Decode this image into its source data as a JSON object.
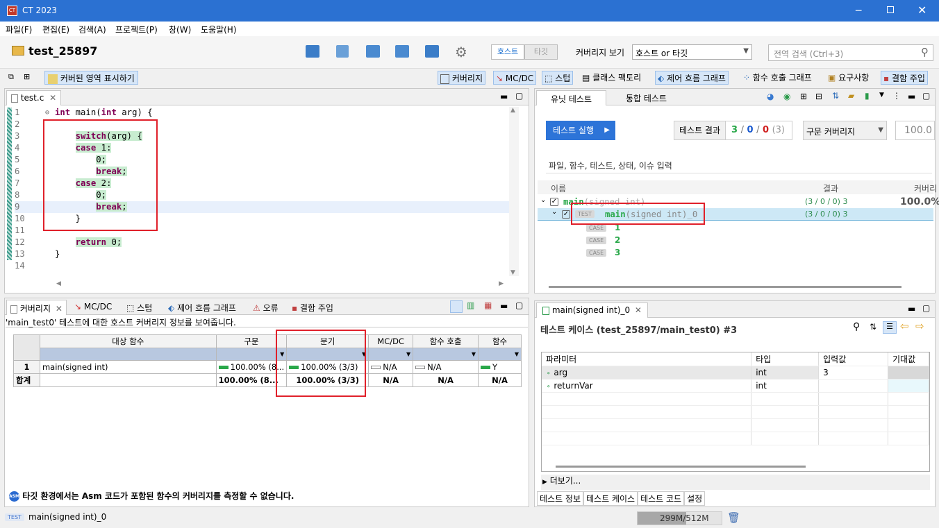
{
  "window": {
    "title": "CT 2023"
  },
  "menu": [
    "파일(F)",
    "편집(E)",
    "검색(A)",
    "프로젝트(P)",
    "창(W)",
    "도움말(H)"
  ],
  "project": {
    "name": "test_25897"
  },
  "toolbar": {
    "host_tab": "호스트",
    "target_tab": "타깃",
    "coverage_view_label": "커버리지 보기",
    "coverage_view_value": "호스트 or 타깃",
    "search_placeholder": "전역 검색 (Ctrl+3)",
    "show_covered": "커버된 영역 표시하기",
    "coverage": "커버리지",
    "mcdc": "MC/DC",
    "stub": "스텁",
    "class_factory": "클래스 팩토리",
    "control_flow": "제어 흐름 그래프",
    "call_graph": "함수 호출 그래프",
    "requirements": "요구사항",
    "fault_injection": "결함 주입"
  },
  "editor": {
    "tab": "test.c",
    "lines": [
      {
        "n": "1",
        "code": "int main(int arg) {"
      },
      {
        "n": "2",
        "code": ""
      },
      {
        "n": "3",
        "code": "    switch(arg) {"
      },
      {
        "n": "4",
        "code": "    case 1:"
      },
      {
        "n": "5",
        "code": "        0;"
      },
      {
        "n": "6",
        "code": "        break;"
      },
      {
        "n": "7",
        "code": "    case 2:"
      },
      {
        "n": "8",
        "code": "        0;"
      },
      {
        "n": "9",
        "code": "        break;"
      },
      {
        "n": "10",
        "code": "    }"
      },
      {
        "n": "11",
        "code": ""
      },
      {
        "n": "12",
        "code": "    return 0;"
      },
      {
        "n": "13",
        "code": "}"
      },
      {
        "n": "14",
        "code": ""
      }
    ]
  },
  "unit_test": {
    "tab_unit": "유닛 테스트",
    "tab_integration": "통합 테스트",
    "run_button": "테스트 실행",
    "result_label": "테스트 결과",
    "result_pass": "3",
    "result_fail": "0",
    "result_error": "0",
    "result_total": "(3)",
    "sep": "/",
    "coverage_type": "구문 커버리지",
    "coverage_value": "100.0",
    "filter_placeholder": "파일, 함수, 테스트, 상태, 이슈 입력",
    "col_name": "이름",
    "col_result": "결과",
    "col_coverage": "커버리",
    "tree": [
      {
        "name": "main",
        "sig": "(signed int)",
        "result": "(3 / 0 / 0) 3",
        "coverage": "100.0%"
      },
      {
        "badge": "TEST",
        "name": "main",
        "sig": "(signed int)_0",
        "result": "(3 / 0 / 0) 3"
      }
    ],
    "cases": [
      {
        "badge": "CASE",
        "label": "1"
      },
      {
        "badge": "CASE",
        "label": "2"
      },
      {
        "badge": "CASE",
        "label": "3"
      }
    ]
  },
  "coverage_panel": {
    "tabs": [
      "커버리지",
      "MC/DC",
      "스텁",
      "제어 흐름 그래프",
      "오류",
      "결함 주입"
    ],
    "info": "'main_test0' 테스트에 대한 호스트 커버리지 정보를 보여줍니다.",
    "headers": [
      "대상 함수",
      "구문",
      "분기",
      "MC/DC",
      "함수 호출",
      "함수"
    ],
    "rows": [
      {
        "idx": "1",
        "func": "main(signed int)",
        "stmt": "100.00% (8...",
        "branch": "100.00% (3/3)",
        "mcdc": "N/A",
        "call": "N/A",
        "func_cov": "Y"
      }
    ],
    "total": {
      "label": "합계",
      "stmt": "100.00% (8...",
      "branch": "100.00% (3/3)",
      "mcdc": "N/A",
      "call": "N/A",
      "func_cov": "N/A"
    },
    "warning": "타깃 환경에서는 Asm 코드가 포함된 함수의 커버리지를 측정할 수 없습니다."
  },
  "testcase_panel": {
    "tab": "main(signed int)_0",
    "title": "테스트 케이스 (test_25897/main_test0) #3",
    "headers": [
      "파라미터",
      "타입",
      "입력값",
      "기대값"
    ],
    "params": [
      {
        "name": "arg",
        "type": "int",
        "input": "3",
        "expected": ""
      },
      {
        "name": "returnVar",
        "type": "int",
        "input": "",
        "expected": ""
      }
    ],
    "more": "더보기...",
    "bottom_tabs": [
      "테스트 정보",
      "테스트 케이스",
      "테스트 코드",
      "설정"
    ]
  },
  "status": {
    "badge": "TEST",
    "text": "main(signed int)_0",
    "memory": "299M/512M"
  },
  "colors": {
    "accent": "#2b71d2",
    "pass": "#2aa84a",
    "fail": "#d02020",
    "highlight": "#c8ecd0"
  }
}
